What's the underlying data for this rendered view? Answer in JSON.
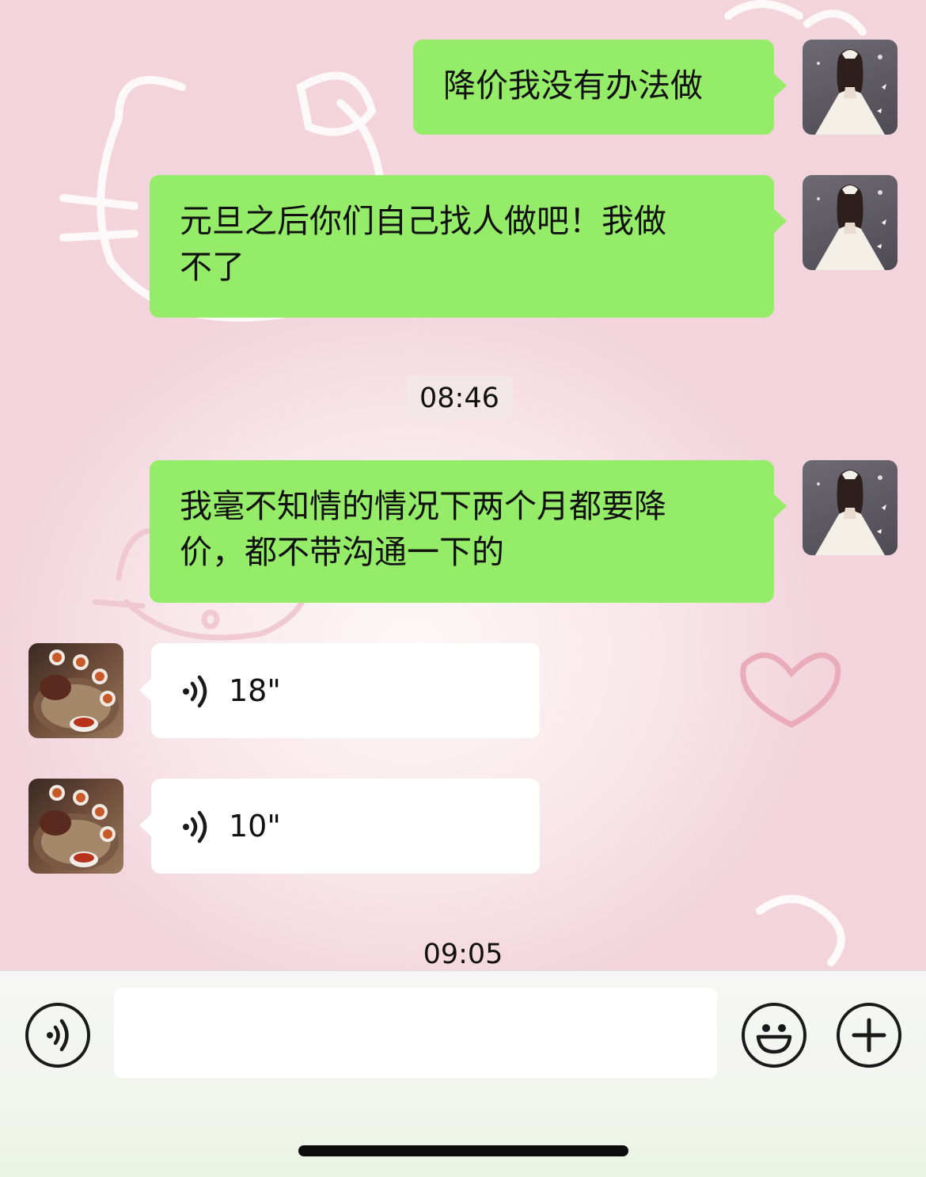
{
  "messages": [
    {
      "sender": "me",
      "type": "text",
      "text": "降价我没有办法做"
    },
    {
      "sender": "me",
      "type": "text",
      "line1": "元旦之后你们自己找人做吧！我做",
      "line2": "不了"
    },
    {
      "type": "timestamp",
      "text": "08:46"
    },
    {
      "sender": "me",
      "type": "text",
      "line1": "我毫不知情的情况下两个月都要降",
      "line2": "价，都不带沟通一下的"
    },
    {
      "sender": "other",
      "type": "voice",
      "duration": "18\""
    },
    {
      "sender": "other",
      "type": "voice",
      "duration": "10\""
    },
    {
      "type": "timestamp",
      "text": "09:05"
    }
  ],
  "avatars": {
    "me": "avatar-girl-white-dress",
    "other": "avatar-tea-set"
  },
  "input_bar": {
    "voice_button_icon": "voice-icon",
    "input_value": "",
    "emoji_button_icon": "emoji-icon",
    "plus_button_icon": "plus-icon"
  },
  "colors": {
    "outgoing_bubble": "#95ec69",
    "incoming_bubble": "#ffffff",
    "background": "#f3d4dc"
  }
}
